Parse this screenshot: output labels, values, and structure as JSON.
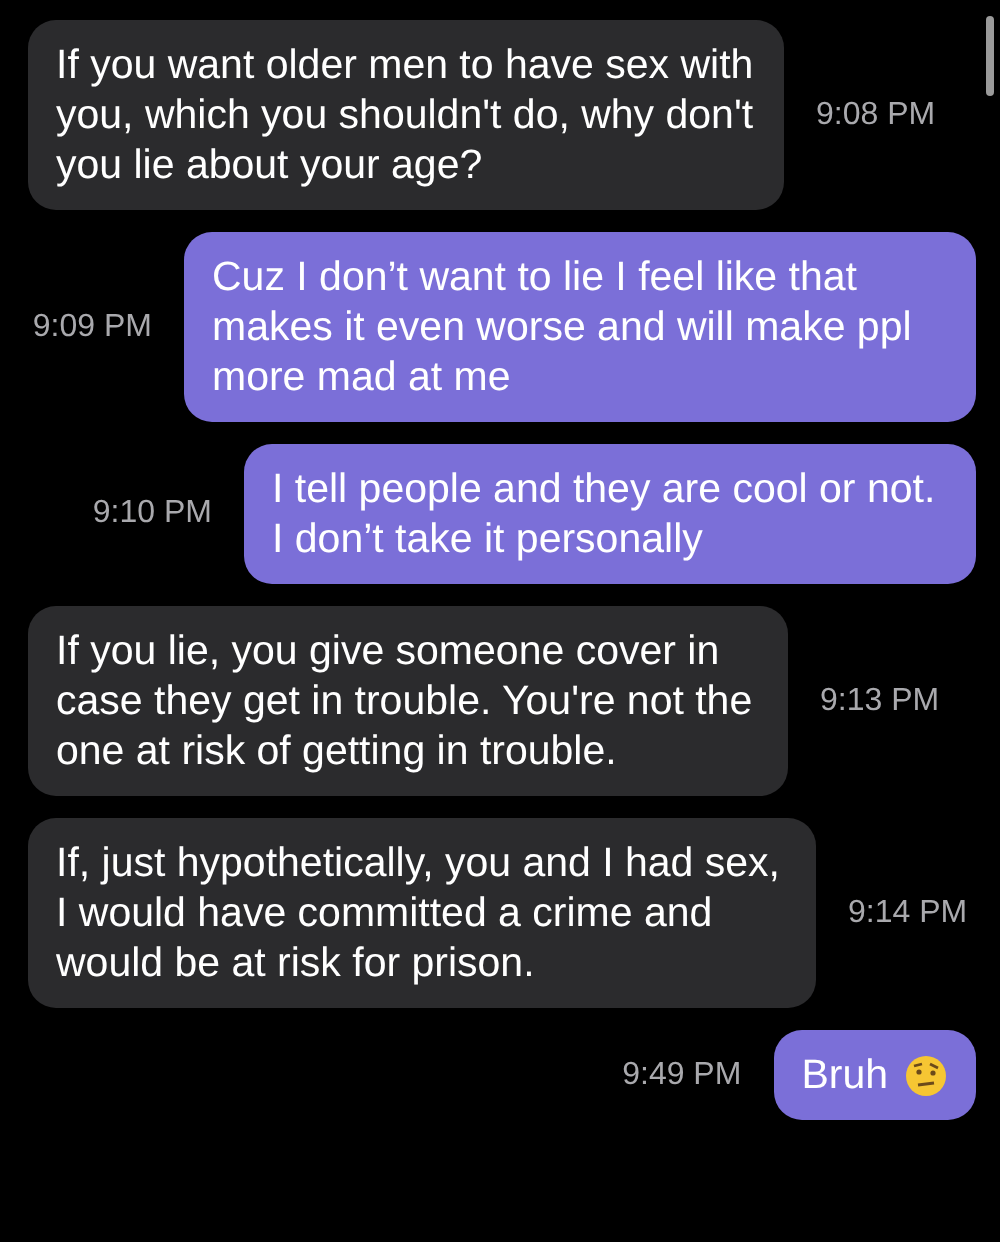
{
  "messages": [
    {
      "kind": "incoming",
      "text": "If you want older men to have sex with you, which you shouldn't do, why don't you lie about your age?",
      "time": "9:08 PM"
    },
    {
      "kind": "outgoing",
      "text": "Cuz I don’t want to lie I feel like that makes it even worse and will make ppl more mad at me",
      "time": "9:09 PM"
    },
    {
      "kind": "outgoing",
      "text": "I tell people and they are cool or not. I don’t take it personally",
      "time": "9:10 PM"
    },
    {
      "kind": "incoming",
      "text": "If you lie, you give someone cover in case they get in trouble. You're not the one at risk of getting in trouble.",
      "time": "9:13 PM"
    },
    {
      "kind": "incoming",
      "text": "If, just hypothetically, you and I had sex, I would have committed a crime and would be at risk for prison.",
      "time": "9:14 PM"
    },
    {
      "kind": "outgoing",
      "text": "Bruh",
      "time": "9:49 PM",
      "emoji": true
    }
  ]
}
